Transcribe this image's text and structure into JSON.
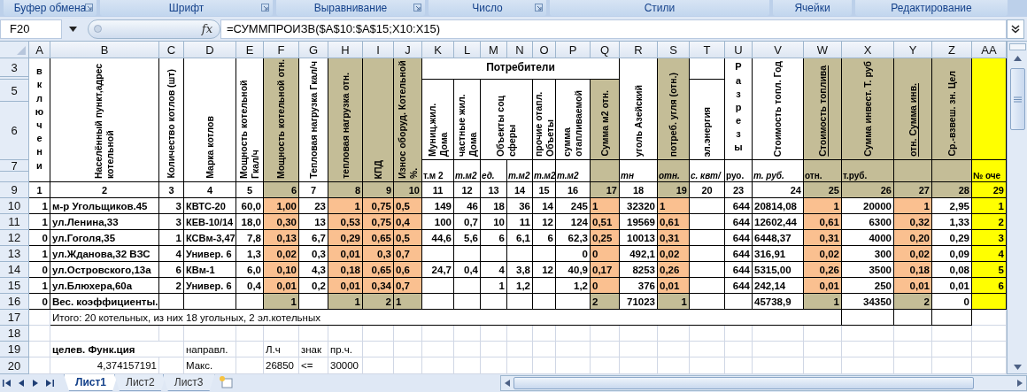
{
  "ribbon_groups": [
    {
      "label": "Буфер обмена",
      "launcher": true
    },
    {
      "label": "Шрифт",
      "launcher": true
    },
    {
      "label": "Выравнивание",
      "launcher": true
    },
    {
      "label": "Число",
      "launcher": true
    },
    {
      "label": "Стили",
      "launcher": false
    },
    {
      "label": "Ячейки",
      "launcher": false
    },
    {
      "label": "Редактирование",
      "launcher": false
    }
  ],
  "formula_bar": {
    "name_box": "F20",
    "fx": "fx",
    "formula": "=СУММПРОИЗВ($A$10:$A$15;X10:X15)"
  },
  "columns": [
    {
      "letter": "A",
      "kind": "plain"
    },
    {
      "letter": "B",
      "kind": "plain"
    },
    {
      "letter": "C",
      "kind": "plain"
    },
    {
      "letter": "D",
      "kind": "plain"
    },
    {
      "letter": "E",
      "kind": "plain"
    },
    {
      "letter": "F",
      "kind": "weighted"
    },
    {
      "letter": "G",
      "kind": "plain"
    },
    {
      "letter": "H",
      "kind": "weighted"
    },
    {
      "letter": "I",
      "kind": "weighted"
    },
    {
      "letter": "J",
      "kind": "weighted"
    },
    {
      "letter": "K",
      "kind": "plain"
    },
    {
      "letter": "L",
      "kind": "plain"
    },
    {
      "letter": "M",
      "kind": "plain"
    },
    {
      "letter": "N",
      "kind": "plain"
    },
    {
      "letter": "O",
      "kind": "plain"
    },
    {
      "letter": "P",
      "kind": "plain"
    },
    {
      "letter": "Q",
      "kind": "weighted"
    },
    {
      "letter": "R",
      "kind": "plain"
    },
    {
      "letter": "S",
      "kind": "weighted"
    },
    {
      "letter": "T",
      "kind": "plain"
    },
    {
      "letter": "U",
      "kind": "plain"
    },
    {
      "letter": "V",
      "kind": "plain"
    },
    {
      "letter": "W",
      "kind": "weighted"
    },
    {
      "letter": "X",
      "kind": "score"
    },
    {
      "letter": "Y",
      "kind": "weighted"
    },
    {
      "letter": "Z",
      "kind": "score"
    },
    {
      "letter": "AA",
      "kind": "rank"
    }
  ],
  "row_numbers": [
    "3",
    "5",
    "6",
    "7",
    "9",
    "10",
    "11",
    "12",
    "13",
    "14",
    "15",
    "16",
    "17",
    "18",
    "19",
    "20"
  ],
  "headers": [
    {
      "text": "включени",
      "kind": "stacked"
    },
    {
      "text": "Населённый пункт,адрес котельной",
      "kind": "vertical"
    },
    {
      "text": "Количество котлов (шт)",
      "kind": "vertical"
    },
    {
      "text": "Марка котлов",
      "kind": "vertical"
    },
    {
      "text": "Мощность  котельной Гкал/ч",
      "kind": "vertical"
    },
    {
      "text": "Мощность  котельной отн.",
      "kind": "vertical"
    },
    {
      "text": "Тепловая нагрузка Гкал/ч",
      "kind": "vertical"
    },
    {
      "text": "тепловая нагрузка отн.",
      "kind": "vertical"
    },
    {
      "text": "КПД",
      "kind": "vertical"
    },
    {
      "text": "Износ оборуд. Котельной %.",
      "kind": "vertical"
    },
    {
      "text": "Потребители",
      "kind": "horizontal"
    },
    {
      "text": "Муниц.жил. Дома",
      "kind": "vertical"
    },
    {
      "text": "частные жил. Дома",
      "kind": "vertical"
    },
    {
      "text": "Объекты соц сферы",
      "kind": "vertical"
    },
    {
      "text": "прочие отапл. Объеты",
      "kind": "vertical"
    },
    {
      "text": "сумма отапливаемой",
      "kind": "vertical"
    },
    {
      "text": "Сумма м2 отн.",
      "kind": "vertical"
    },
    {
      "text": "уголь Азейский",
      "kind": "vertical"
    },
    {
      "text": "потреб. угля  (отн.)",
      "kind": "vertical"
    },
    {
      "text": "эл.энергия",
      "kind": "vertical"
    },
    {
      "text": "Разрезы",
      "kind": "stacked"
    },
    {
      "text": "Стоимость топл. Год",
      "kind": "vertical"
    },
    {
      "text": "Стоимость топлива",
      "kind": "underlined"
    },
    {
      "text": "Сумма инвест. Т. руб",
      "kind": "vertical"
    },
    {
      "text": "отн. Сумма инв.",
      "kind": "underlined"
    },
    {
      "text": "Ср.-взвеш.  зн.  Цел",
      "kind": "vertical"
    }
  ],
  "units": [
    {
      "text": "т.м 2",
      "italic": false
    },
    {
      "text": "т.м2",
      "italic": true
    },
    {
      "text": "ед.",
      "italic": true
    },
    {
      "text": "т.м2",
      "italic": true
    },
    {
      "text": "т.м2",
      "italic": true
    },
    {
      "text": "т.м2",
      "italic": true
    },
    {
      "text": "тн",
      "italic": true
    },
    {
      "text": "отн.",
      "italic": true
    },
    {
      "text": "с. квт/",
      "italic": true
    },
    {
      "text": "руо.",
      "italic": false
    },
    {
      "text": "т. руб.",
      "italic": true
    },
    {
      "text": "отн.",
      "italic": false
    },
    {
      "text": "т.руб.",
      "italic": false
    },
    {
      "text": "№ оче",
      "italic": false
    }
  ],
  "column_numbers": [
    "1",
    "2",
    "3",
    "4",
    "5",
    "6",
    "7",
    "8",
    "9",
    "10",
    "11",
    "12",
    "13",
    "14",
    "15",
    "16",
    "17",
    "18",
    "19",
    "20",
    "23",
    "24",
    "25",
    "26",
    "27",
    "28",
    "29"
  ],
  "rows": [
    {
      "kind": "data",
      "cells": [
        "1",
        "м-р Угольщиков.45",
        "3",
        "КВТС-20",
        "60,0",
        "1,00",
        "23",
        "1",
        "0,75",
        "0,5",
        "149",
        "46",
        "18",
        "36",
        "14",
        "245",
        "1",
        "32320",
        "1",
        null,
        "644",
        "20814,08",
        "1",
        "20000",
        "1",
        "2,95",
        "1"
      ]
    },
    {
      "kind": "data",
      "cells": [
        "1",
        "ул.Ленина,33",
        "3",
        "КЕВ-10/14",
        "18,0",
        "0,30",
        "13",
        "0,53",
        "0,75",
        "0,4",
        "100",
        "0,7",
        "10",
        "11",
        "12",
        "124",
        "0,51",
        "19569",
        "0,61",
        null,
        "644",
        "12602,44",
        "0,61",
        "6300",
        "0,32",
        "1,33",
        "2"
      ]
    },
    {
      "kind": "data",
      "cells": [
        "0",
        "ул.Гоголя,35",
        "1",
        "КСВм-3,47",
        "7,8",
        "0,13",
        "6,7",
        "0,29",
        "0,65",
        "0,5",
        "44,6",
        "5,6",
        "6",
        "6,1",
        "6",
        "62,3",
        "0,25",
        "10013",
        "0,31",
        null,
        "644",
        "6448,37",
        "0,31",
        "4000",
        "0,20",
        "0,29",
        "3"
      ]
    },
    {
      "kind": "data",
      "cells": [
        "1",
        "ул.Жданова,32 ВЗС",
        "4",
        "Универ. 6",
        "1,3",
        "0,02",
        "0,3",
        "0,01",
        "0,3",
        "0,7",
        null,
        null,
        null,
        null,
        null,
        "0",
        "0",
        "492,1",
        "0,02",
        null,
        "644",
        "316,91",
        "0,02",
        "300",
        "0,02",
        "0,09",
        "4"
      ]
    },
    {
      "kind": "data",
      "cells": [
        "0",
        "ул.Островского,13а",
        "6",
        "КВм-1",
        "6,0",
        "0,10",
        "4,3",
        "0,18",
        "0,65",
        "0,6",
        "24,7",
        "0,4",
        "4",
        "3,8",
        "12",
        "40,9",
        "0,17",
        "8253",
        "0,26",
        null,
        "644",
        "5315,00",
        "0,26",
        "3500",
        "0,18",
        "0,08",
        "5"
      ]
    },
    {
      "kind": "data",
      "cells": [
        "1",
        "ул.Блюхера,60а",
        "2",
        "Универ. 6",
        "0,4",
        "0,01",
        "0,2",
        "0,01",
        "0,34",
        "0,7",
        null,
        null,
        "1",
        "1,2",
        null,
        "1,2",
        "0",
        "376",
        "0,01",
        null,
        "644",
        "242,14",
        "0,01",
        "250",
        "0,01",
        "0,01",
        "6"
      ]
    },
    {
      "kind": "total",
      "cells": [
        "0",
        "Вес. коэффициенты.",
        null,
        null,
        null,
        "1",
        null,
        "1",
        "2",
        "1",
        null,
        null,
        null,
        null,
        null,
        null,
        "2",
        "71023",
        "1",
        null,
        null,
        "45738,9",
        "1",
        "34350",
        "2",
        "0",
        null
      ]
    }
  ],
  "summary": "Итого: 20 котельных, из них 18 угольных, 2 эл.котельных",
  "solver": {
    "objective_label": "целев. Функ.ция",
    "objective_value": "4,374157191",
    "direction_label": "направл.",
    "direction": "Макс.",
    "lhs_label": "Л.ч",
    "lhs": "26850",
    "sign_label": "знак",
    "sign": "<=",
    "rhs_label": "пр.ч.",
    "rhs": "30000"
  },
  "sheet_tabs": [
    {
      "label": "Лист1",
      "selected": true
    },
    {
      "label": "Лист2",
      "selected": false
    },
    {
      "label": "Лист3",
      "selected": false
    }
  ]
}
